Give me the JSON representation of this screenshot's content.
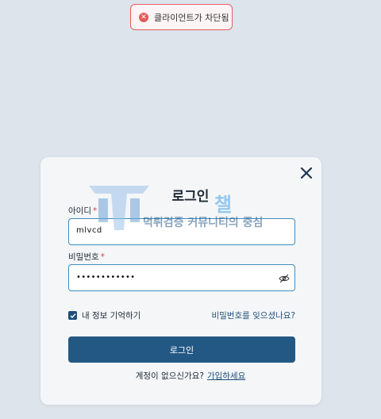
{
  "toast": {
    "icon": "error-x-icon",
    "message": "클라이언트가 차단됨",
    "accent": "#e35d5d"
  },
  "login": {
    "title": "로그인",
    "close_icon": "close-icon",
    "id_label": "아이디",
    "id_value": "mlvcd",
    "password_label": "비밀번호",
    "password_value": "••••••••••••",
    "required_mark": "*",
    "remember_label": "내 정보 기억하기",
    "remember_checked": true,
    "forgot_link": "비밀번호를 잊으셨나요?",
    "submit_label": "로그인",
    "no_account_text": "계정이 없으신가요?",
    "signup_link": "가입하세요",
    "primary_color": "#245884"
  },
  "watermark": {
    "logo_text": "챌",
    "text": "먹튀검증 커뮤니티의 중심"
  }
}
